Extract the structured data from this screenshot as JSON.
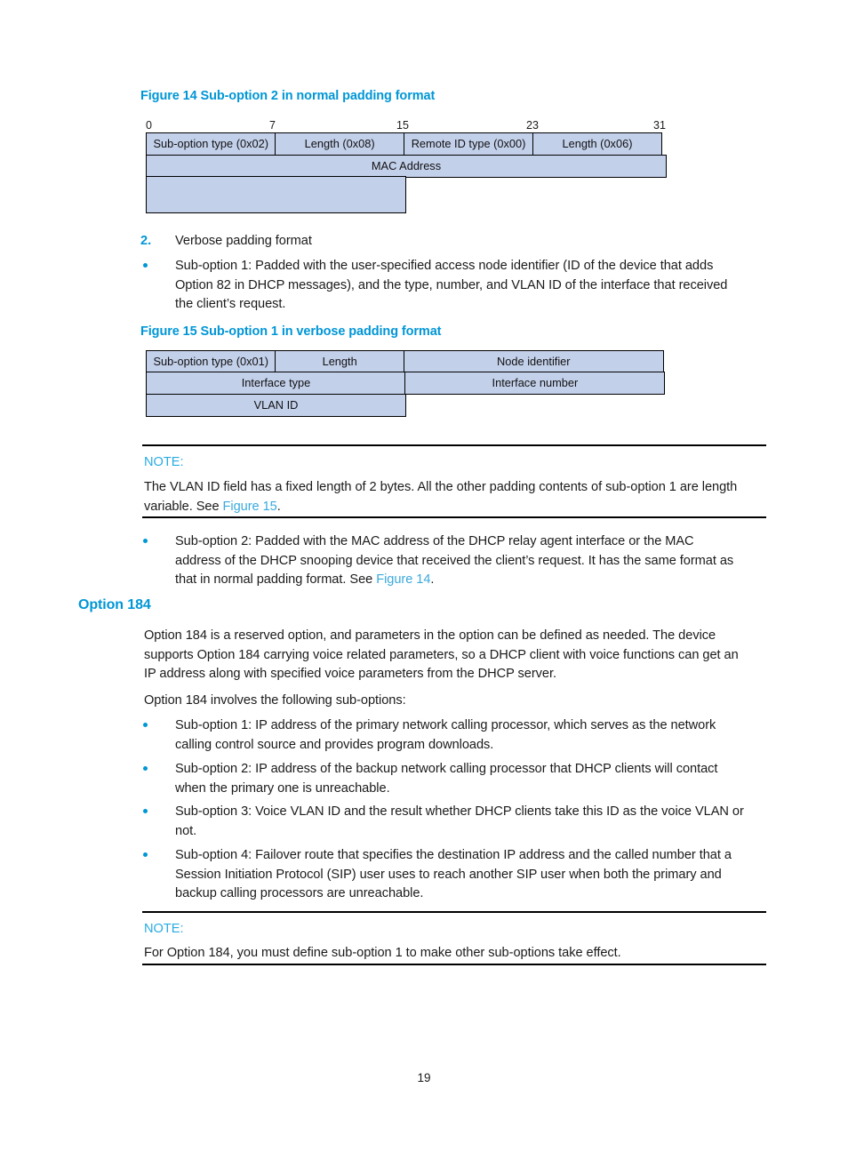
{
  "document": {
    "page_number": "19"
  },
  "figure14": {
    "caption": "Figure 14 Sub-option 2 in normal padding format",
    "bit_ruler": [
      "0",
      "7",
      "15",
      "23",
      "31"
    ],
    "rows": [
      [
        "Sub-option type (0x02)",
        "Length (0x08)",
        "Remote ID type (0x00)",
        "Length (0x06)"
      ],
      [
        "MAC Address"
      ],
      [
        ""
      ]
    ]
  },
  "figure15": {
    "caption": "Figure 15 Sub-option 1 in verbose padding format",
    "rows": [
      [
        "Sub-option type (0x01)",
        "Length",
        "Node identifier"
      ],
      [
        "Interface type",
        "Interface number"
      ],
      [
        "VLAN ID"
      ]
    ]
  },
  "verbose_section": {
    "number": "2.",
    "title": "Verbose padding format",
    "bullet1_line1": "Sub-option 1: Padded with the user-specified access node identifier (ID of the device that adds",
    "bullet1_line2": "Option 82 in DHCP messages), and the type, number, and VLAN ID of the interface that received",
    "bullet1_line3": "the client’s request."
  },
  "note1": {
    "label": "NOTE:",
    "line1": "The VLAN ID field has a fixed length of 2 bytes. All the other padding contents of sub-option 1 are length",
    "line2_before": "variable. See ",
    "line2_link": "Figure 15",
    "line2_after": "."
  },
  "suboption2_bullet": {
    "line1": "Sub-option 2: Padded with the MAC address of the DHCP relay agent interface or the MAC",
    "line2": "address of the DHCP snooping device that received the client’s request. It has the same format as",
    "line3_before": "that in normal padding format. See ",
    "line3_link": "Figure 14",
    "line3_after": "."
  },
  "option184": {
    "heading": "Option 184",
    "intro_line1": "Option 184 is a reserved option, and parameters in the option can be defined as needed. The device",
    "intro_line2": "supports Option 184 carrying voice related parameters, so a DHCP client with voice functions can get an",
    "intro_line3": "IP address along with specified voice parameters from the DHCP server.",
    "lead_in": "Option 184 involves the following sub-options:",
    "bullets": [
      {
        "line1": "Sub-option 1: IP address of the primary network calling processor, which serves as the network",
        "line2": "calling control source and provides program downloads.",
        "line3": ""
      },
      {
        "line1": "Sub-option 2: IP address of the backup network calling processor that DHCP clients will contact",
        "line2": "when the primary one is unreachable.",
        "line3": ""
      },
      {
        "line1": "Sub-option 3: Voice VLAN ID and the result whether DHCP clients take this ID as the voice VLAN or",
        "line2": "not.",
        "line3": ""
      },
      {
        "line1": "Sub-option 4: Failover route that specifies the destination IP address and the called number that a",
        "line2": "Session Initiation Protocol (SIP) user uses to reach another SIP user when both the primary and",
        "line3": "backup calling processors are unreachable."
      }
    ]
  },
  "note2": {
    "label": "NOTE:",
    "line1": "For Option 184, you must define sub-option 1 to make other sub-options take effect."
  }
}
